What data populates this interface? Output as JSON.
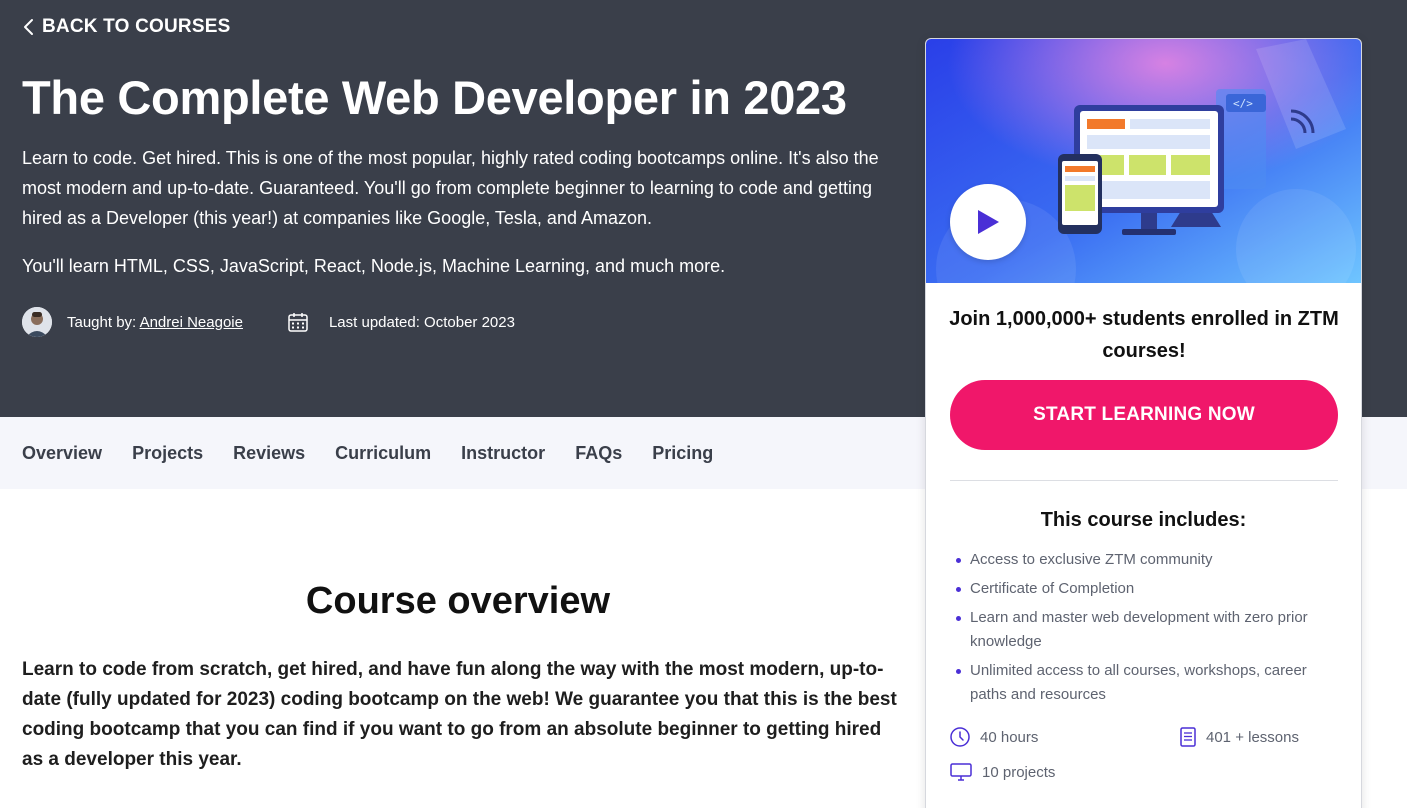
{
  "hero": {
    "back_label": "BACK TO COURSES",
    "title": "The Complete Web Developer in 2023",
    "description": "Learn to code. Get hired. This is one of the most popular, highly rated coding bootcamps online. It's also the most modern and up-to-date. Guaranteed. You'll go from complete beginner to learning to code and getting hired as a Developer (this year!) at companies like Google, Tesla, and Amazon.",
    "learn": "You'll learn HTML, CSS, JavaScript, React, Node.js, Machine Learning, and much more.",
    "taught_by_label": "Taught by:",
    "author": "Andrei Neagoie",
    "last_updated": "Last updated: October 2023"
  },
  "tabs": [
    "Overview",
    "Projects",
    "Reviews",
    "Curriculum",
    "Instructor",
    "FAQs",
    "Pricing"
  ],
  "overview": {
    "title": "Course overview",
    "text": "Learn to code from scratch, get hired, and have fun along the way with the most modern, up-to-date (fully updated for 2023) coding bootcamp on the web! We guarantee you that this is the best coding bootcamp that you can find if you want to go from an absolute beginner to getting hired as a developer this year."
  },
  "card": {
    "join_text": "Join 1,000,000+ students enrolled in ZTM courses!",
    "cta_label": "START LEARNING NOW",
    "includes_title": "This course includes:",
    "includes": [
      "Access to exclusive ZTM community",
      "Certificate of Completion",
      "Learn and master web development with zero prior knowledge",
      "Unlimited access to all courses, workshops, career paths and resources"
    ],
    "stats": {
      "hours": "40 hours",
      "lessons": "401 + lessons",
      "projects": "10 projects"
    }
  },
  "colors": {
    "hero_bg": "#3a3f4a",
    "tabs_bg": "#f5f6fb",
    "cta": "#f0176a",
    "accent": "#4a2fd6"
  }
}
